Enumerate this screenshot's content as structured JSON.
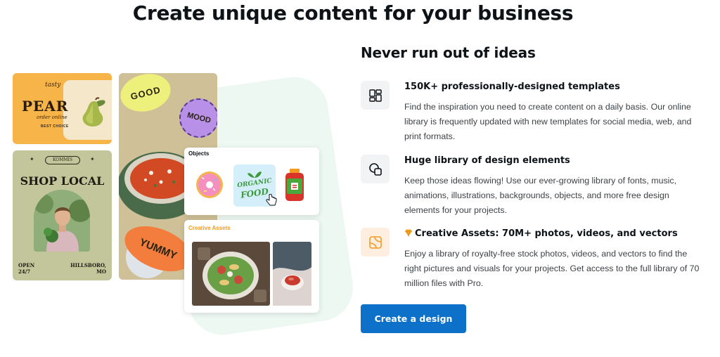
{
  "headline": "Create unique content for your business",
  "collage": {
    "pear_card": {
      "tasty": "tasty",
      "title": "PEAR",
      "order": "order online",
      "best": "BEST CHOICE"
    },
    "shop_card": {
      "badge": "KOMMIS",
      "title": "SHOP LOCAL",
      "open_line1": "OPEN",
      "open_line2": "24/7",
      "location_line1": "HILLSBORO,",
      "location_line2": "MO"
    },
    "soup_card": {
      "sticker_good": "GOOD",
      "sticker_mood": "MOOD",
      "sticker_yummy": "YUMMY"
    },
    "objects_panel": {
      "title": "Objects",
      "organic_line1": "ORGANIC",
      "organic_line2": "FOOD"
    },
    "assets_panel": {
      "title": "Creative Assets"
    }
  },
  "subtitle": "Never run out of ideas",
  "features": [
    {
      "icon": "templates-grid-icon",
      "title": "150K+ professionally-designed templates",
      "desc": "Find the inspiration you need to create content on a daily basis. Our online library is frequently updated with new templates for social media, web, and print formats."
    },
    {
      "icon": "shapes-icon",
      "title": "Huge library of design elements",
      "desc": "Keep those ideas flowing! Use our ever-growing library of fonts, music, animations, illustrations, backgrounds, objects, and more free design elements for your projects."
    },
    {
      "icon": "creative-assets-icon",
      "title": "Creative Assets: 70M+ photos, videos, and vectors",
      "desc": "Enjoy a library of royalty-free stock photos, videos, and vectors to find the right pictures and visuals for your projects. Get access to the full library of 70 million files with Pro."
    }
  ],
  "cta_label": "Create a design",
  "colors": {
    "accent": "#0d70c9",
    "pro_orange": "#f39b1f",
    "text": "#0e1318"
  }
}
